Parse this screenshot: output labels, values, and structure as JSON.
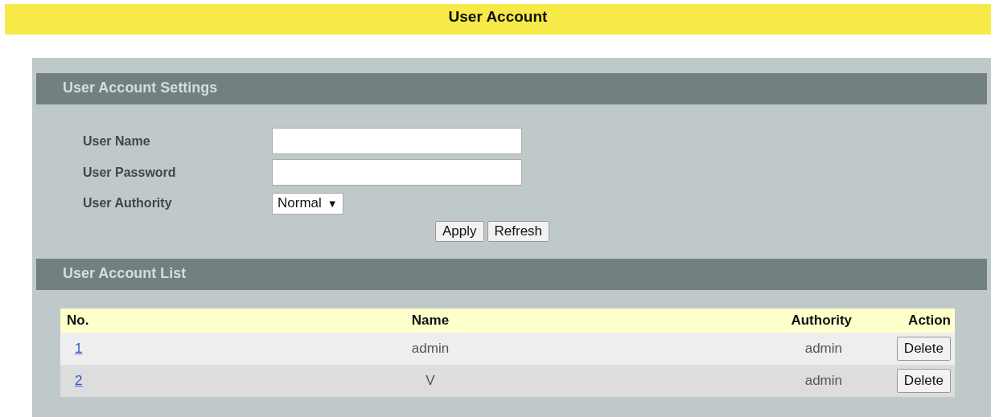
{
  "title": "User Account",
  "settings": {
    "heading": "User Account Settings",
    "fields": [
      {
        "kind": "text",
        "label": "User Name"
      },
      {
        "kind": "password",
        "label": "User Password"
      },
      {
        "kind": "select",
        "label": "User Authority",
        "value": "Normal",
        "caret": "▼"
      }
    ],
    "buttons": [
      "Apply",
      "Refresh"
    ]
  },
  "list": {
    "heading": "User Account List",
    "columns": [
      "No.",
      "Name",
      "Authority",
      "Action"
    ],
    "rows": [
      {
        "no": "1",
        "name": "admin",
        "authority": "admin",
        "action": "Delete"
      },
      {
        "no": "2",
        "name": "V",
        "authority": "admin",
        "action": "Delete"
      }
    ]
  }
}
